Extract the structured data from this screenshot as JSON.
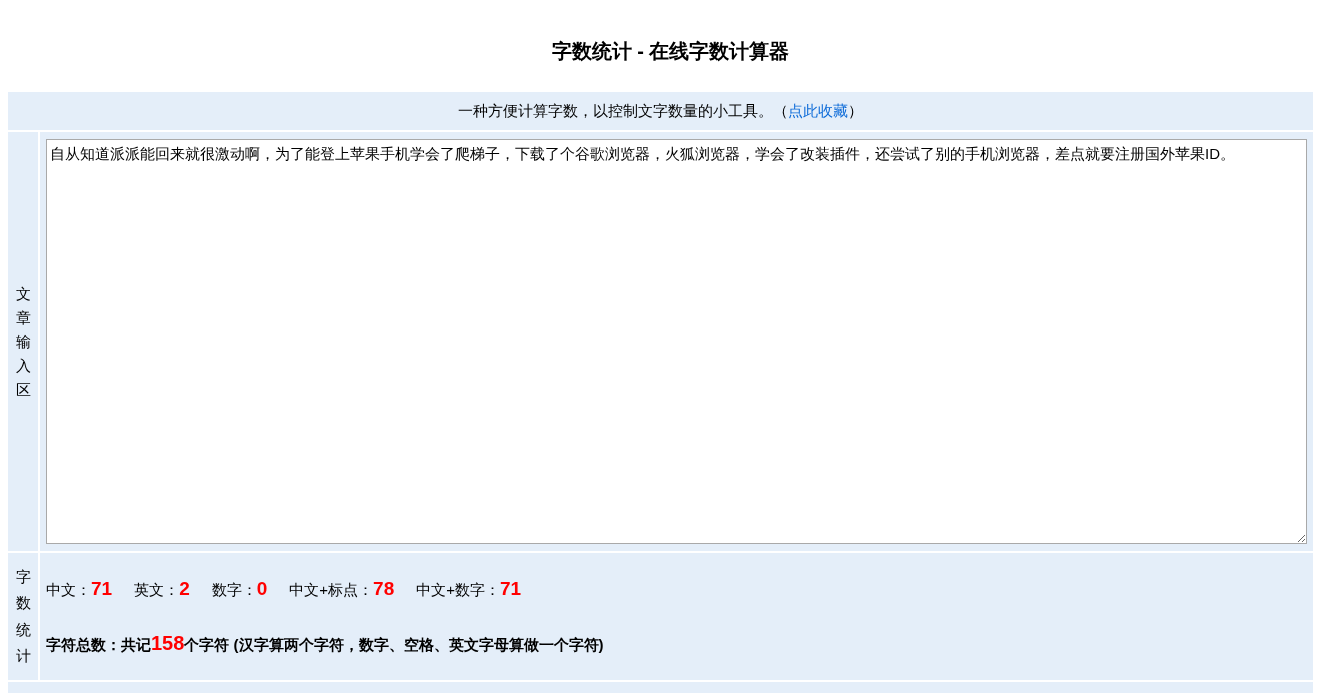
{
  "title": "字数统计 - 在线字数计算器",
  "intro": {
    "text": "一种方便计算字数，以控制文字数量的小工具。",
    "paren_open": "（",
    "link": "点此收藏",
    "paren_close": "）"
  },
  "input_section": {
    "label": "文章输入区",
    "value": "自从知道派派能回来就很激动啊，为了能登上苹果手机学会了爬梯子，下载了个谷歌浏览器，火狐浏览器，学会了改装插件，还尝试了别的手机浏览器，差点就要注册国外苹果ID。"
  },
  "stats_section": {
    "label": "字数统计",
    "stats": [
      {
        "label": "中文：",
        "value": "71"
      },
      {
        "label": "英文：",
        "value": "2"
      },
      {
        "label": "数字：",
        "value": "0"
      },
      {
        "label": "中文+标点：",
        "value": "78"
      },
      {
        "label": "中文+数字：",
        "value": "71"
      }
    ],
    "total": {
      "prefix": "字符总数：共记",
      "count": "158",
      "suffix": "个字符 (汉字算两个字符，数字、空格、英文字母算做一个字符)"
    }
  }
}
